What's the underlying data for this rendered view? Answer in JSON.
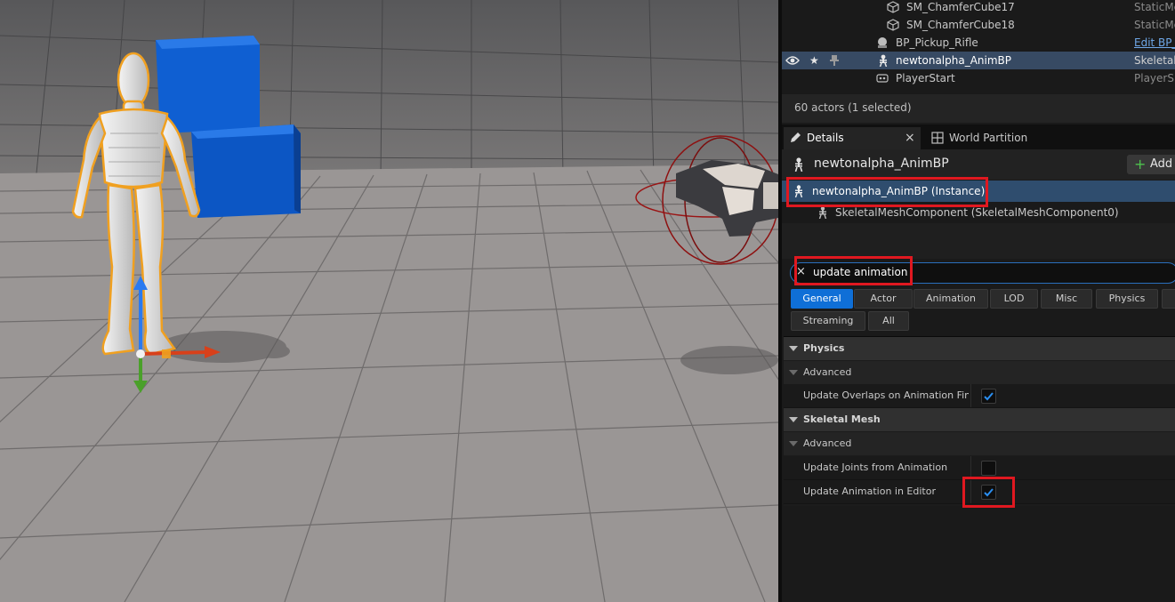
{
  "outliner": {
    "rows": [
      {
        "name": "SM_ChamferCube17",
        "type": "StaticMe",
        "icon": "static-mesh-icon",
        "selected": false
      },
      {
        "name": "SM_ChamferCube18",
        "type": "StaticMe",
        "icon": "static-mesh-icon",
        "selected": false
      },
      {
        "name": "BP_Pickup_Rifle",
        "type": "Edit BP_",
        "icon": "blueprint-actor-icon",
        "selected": false
      },
      {
        "name": "newtonalpha_AnimBP",
        "type": "Skeletal",
        "icon": "skeleton-icon",
        "selected": true
      },
      {
        "name": "PlayerStart",
        "type": "PlayerS",
        "icon": "player-start-icon",
        "selected": false
      }
    ],
    "selected_row_controls": {
      "visibility": "eye-icon",
      "star": "★",
      "pin": "pin-icon"
    },
    "actor_count": "60 actors (1 selected)"
  },
  "tabs": {
    "details": "Details",
    "world_partition": "World Partition",
    "close_glyph": "×"
  },
  "details": {
    "actor_name": "newtonalpha_AnimBP",
    "add_button": "Add",
    "components": {
      "instance": "newtonalpha_AnimBP (Instance)",
      "skeletal_mesh": "SkeletalMeshComponent (SkeletalMeshComponent0)"
    },
    "search": {
      "value": "update animation",
      "clear_glyph": "×"
    },
    "filters": [
      "General",
      "Actor",
      "Animation",
      "LOD",
      "Misc",
      "Physics",
      "Streaming",
      "All"
    ],
    "active_filter": "General",
    "sections": [
      {
        "title": "Physics",
        "advanced": "Advanced",
        "properties": [
          {
            "label": "Update Overlaps on Animation Fina...",
            "checked": true
          }
        ]
      },
      {
        "title": "Skeletal Mesh",
        "advanced": "Advanced",
        "properties": [
          {
            "label": "Update Joints from Animation",
            "checked": false
          },
          {
            "label": "Update Animation in Editor",
            "checked": true
          }
        ]
      }
    ]
  },
  "colors": {
    "selection": "#374a63",
    "active_filter": "#0f6fd7",
    "highlight_box": "#e01820",
    "selection_outline": "#f0a020"
  }
}
